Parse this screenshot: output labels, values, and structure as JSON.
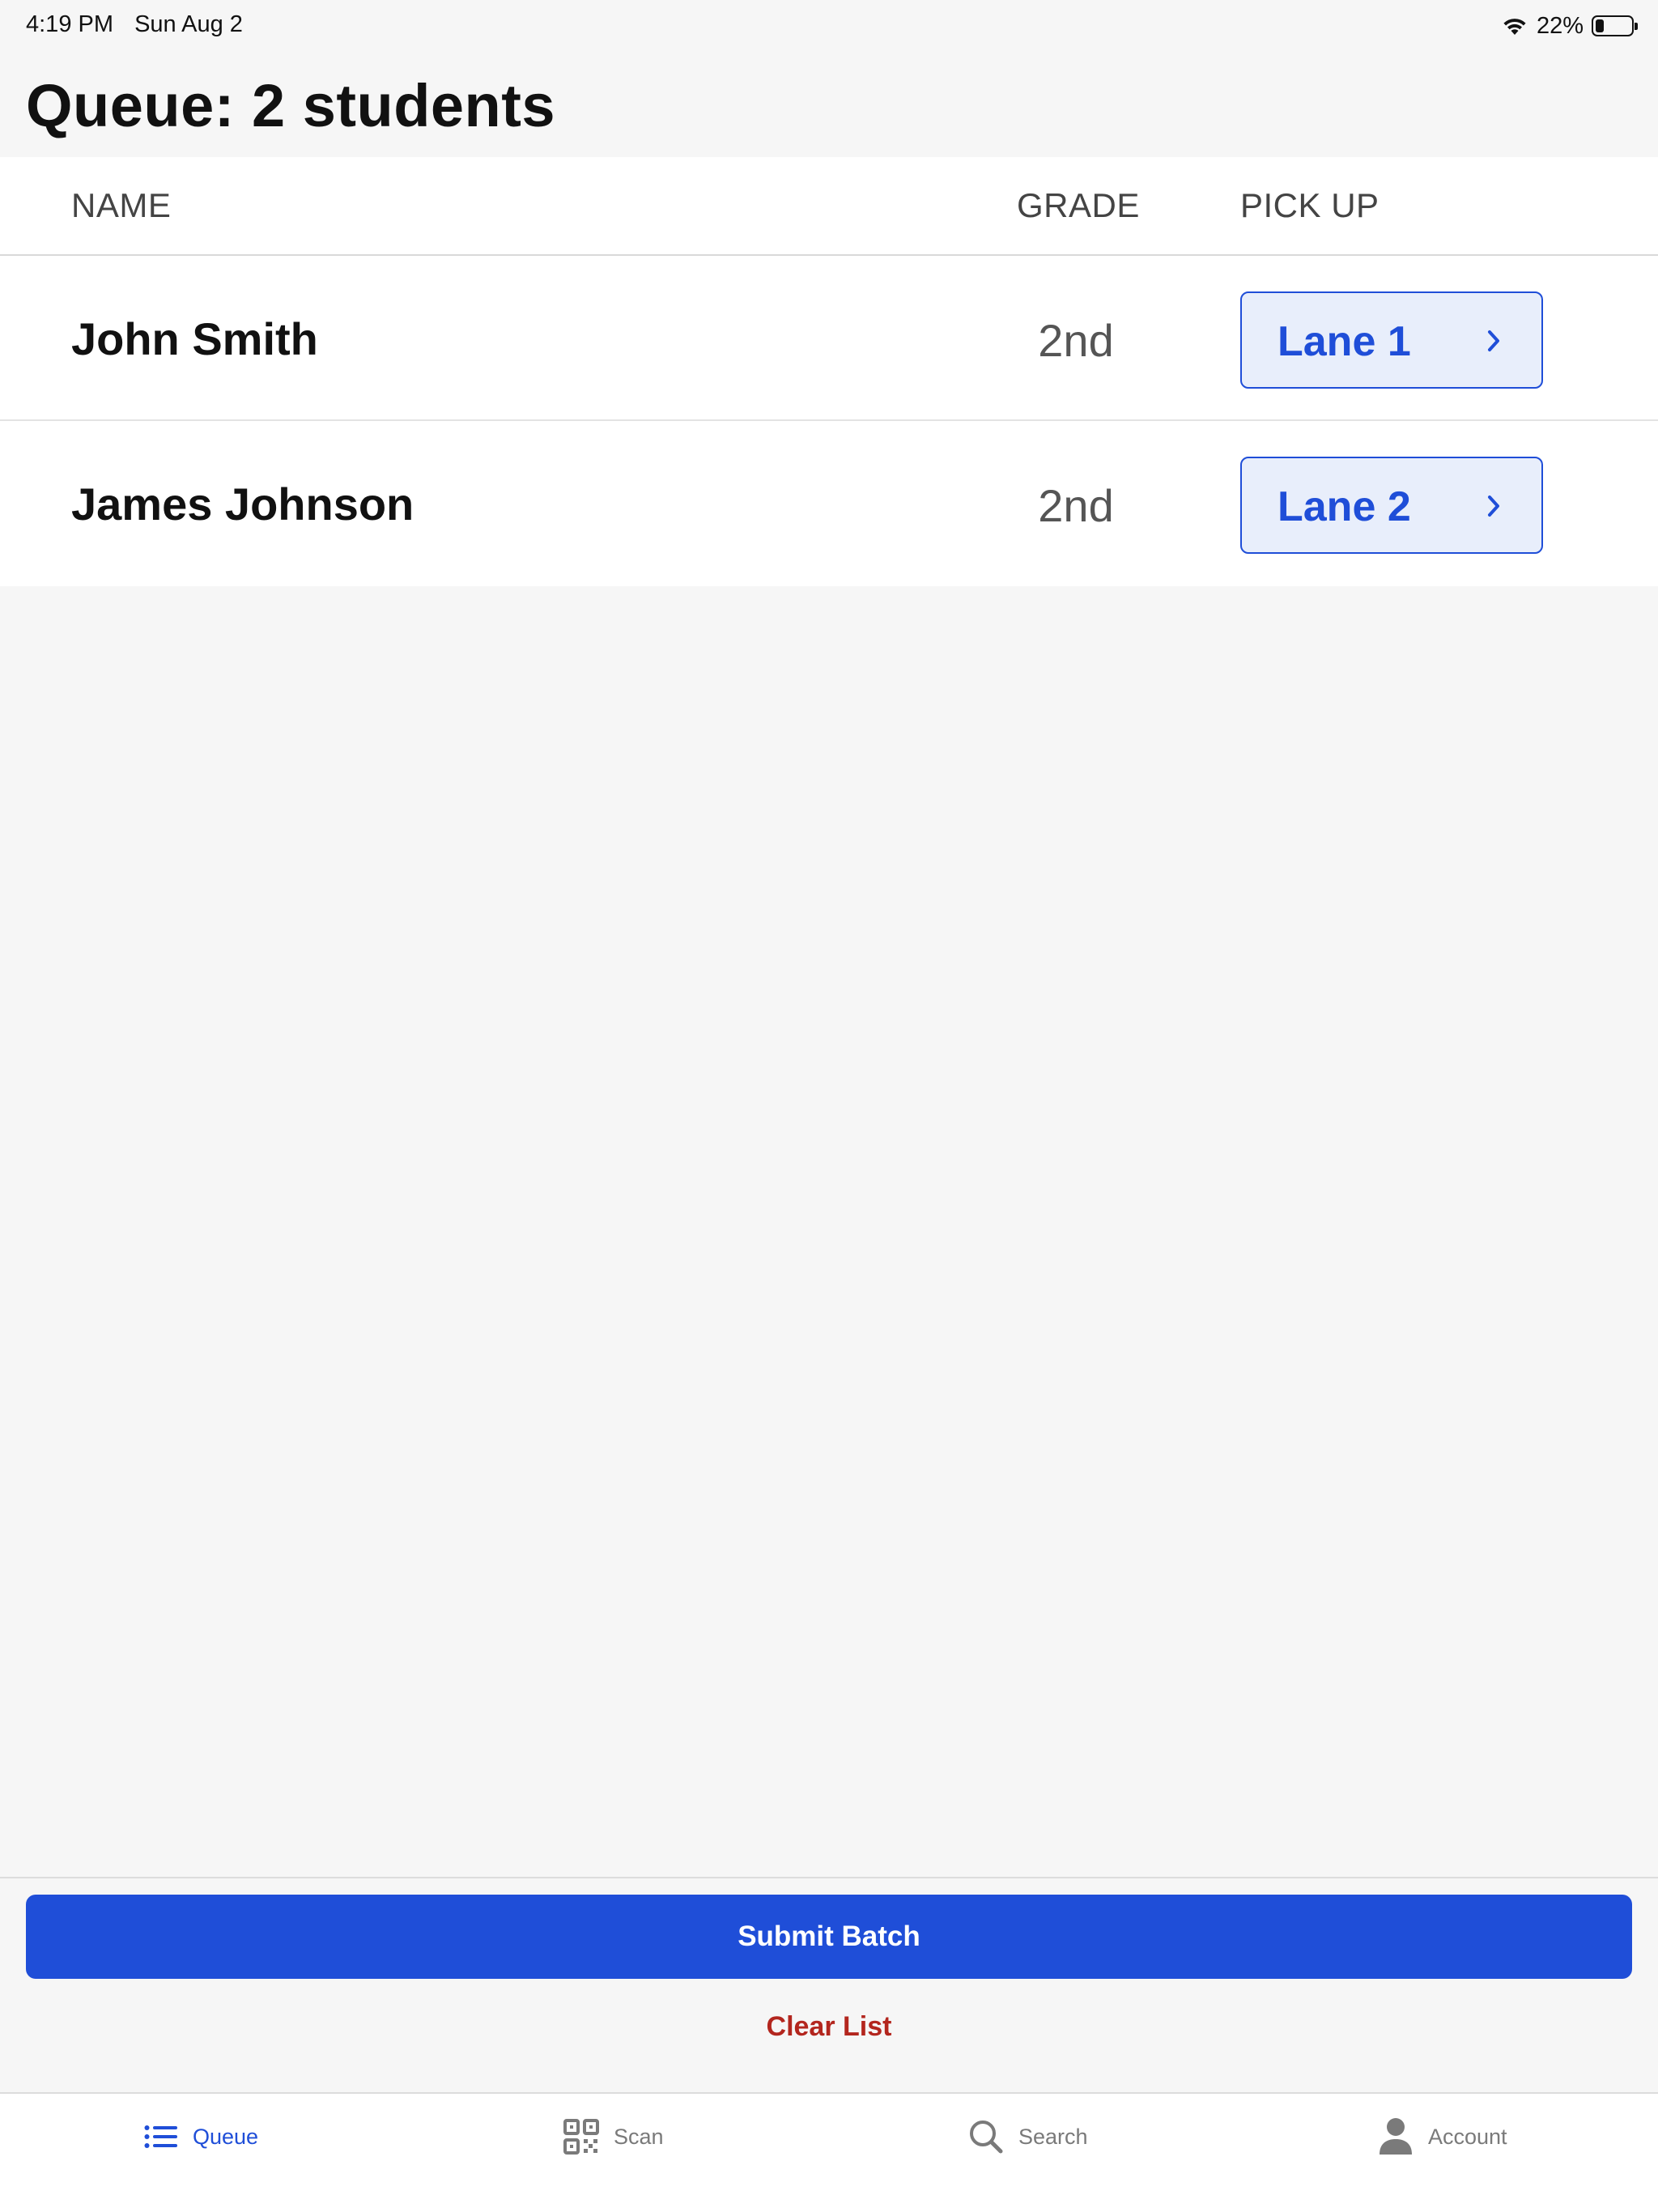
{
  "status_bar": {
    "time": "4:19 PM",
    "date": "Sun Aug 2",
    "battery_percent": "22%",
    "battery_level": 0.22,
    "icons": [
      "wifi-icon",
      "battery-icon"
    ]
  },
  "title": "Queue: 2 students",
  "table": {
    "headers": {
      "name": "NAME",
      "grade": "GRADE",
      "pickup": "PICK UP"
    },
    "rows": [
      {
        "name": "John Smith",
        "grade": "2nd",
        "pickup": "Lane 1"
      },
      {
        "name": "James Johnson",
        "grade": "2nd",
        "pickup": "Lane 2"
      }
    ]
  },
  "actions": {
    "submit_label": "Submit Batch",
    "clear_label": "Clear List"
  },
  "tabbar": {
    "items": [
      {
        "label": "Queue",
        "icon": "list-icon",
        "active": true
      },
      {
        "label": "Scan",
        "icon": "qr-code-icon",
        "active": false
      },
      {
        "label": "Search",
        "icon": "search-icon",
        "active": false
      },
      {
        "label": "Account",
        "icon": "person-icon",
        "active": false
      }
    ]
  },
  "colors": {
    "accent": "#1f4ed8",
    "accent_light": "#e8eefb",
    "destructive": "#b3261e",
    "background": "#f6f6f6",
    "inactive": "#7a7a7a"
  }
}
